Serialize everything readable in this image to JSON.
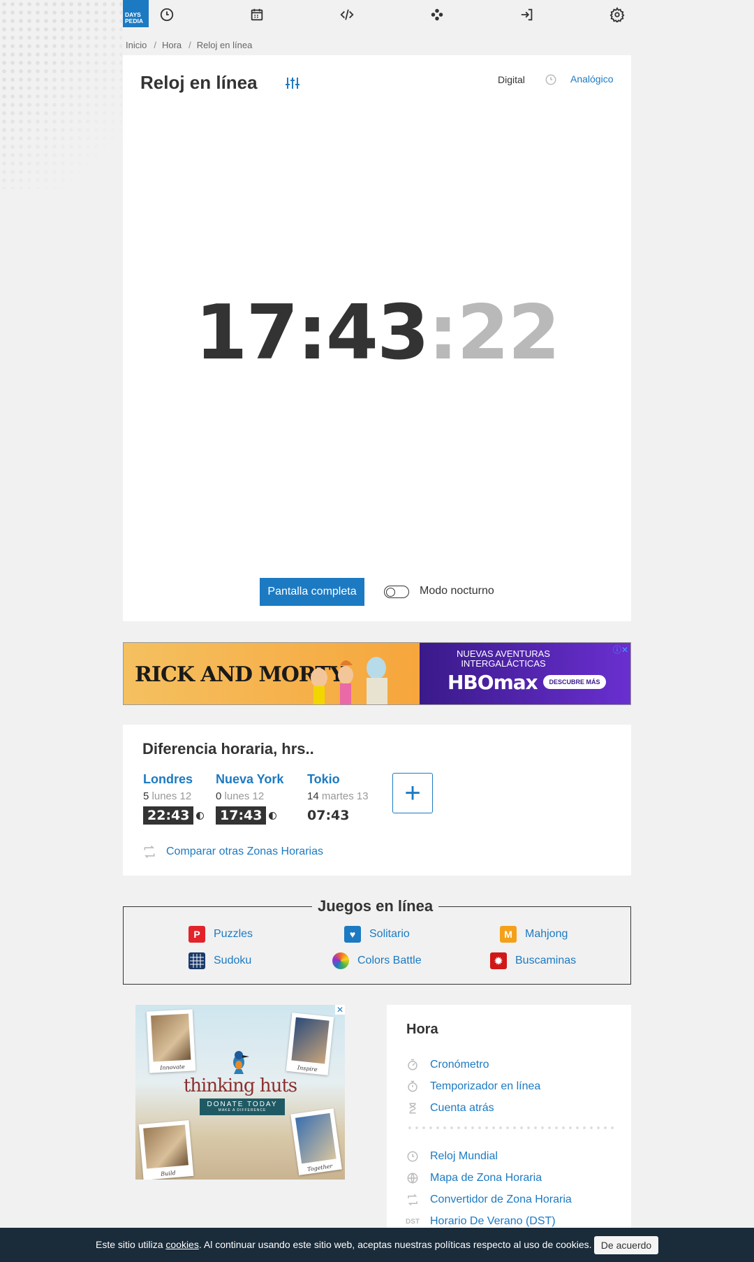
{
  "logo": {
    "line1": "DAYS",
    "line2": "PEDIA"
  },
  "breadcrumb": {
    "items": [
      "Inicio",
      "Hora",
      "Reloj en línea"
    ],
    "sep": "/"
  },
  "clock": {
    "title": "Reloj en línea",
    "mode_digital": "Digital",
    "mode_analog": "Analógico",
    "time_hm": "17:43",
    "time_sec": ":22",
    "fullscreen_label": "Pantalla completa",
    "night_mode_label": "Modo nocturno",
    "night_mode_on": false
  },
  "ad_banner": {
    "brand_left": "RICK AND MORTY",
    "headline": "NUEVAS AVENTURAS INTERGALÁCTICAS",
    "brand_right": "HBOmax",
    "cta": "DESCUBRE MÁS",
    "info": "ⓘ✕"
  },
  "time_diff": {
    "title": "Diferencia horaria, hrs..",
    "cities": [
      {
        "name": "Londres",
        "offset": "5",
        "day": "lunes 12",
        "time": "22:43",
        "night": true
      },
      {
        "name": "Nueva York",
        "offset": "0",
        "day": "lunes 12",
        "time": "17:43",
        "night": true
      },
      {
        "name": "Tokio",
        "offset": "14",
        "day": "martes 13",
        "time": "07:43",
        "night": false
      }
    ],
    "add_label": "+",
    "compare_label": "Comparar otras Zonas Horarias"
  },
  "games": {
    "title": "Juegos en línea",
    "items": [
      {
        "label": "Puzzles",
        "icon": "puzzle-icon",
        "color": "#e2232a"
      },
      {
        "label": "Solitario",
        "icon": "heart-card-icon",
        "color": "#1c7ac2"
      },
      {
        "label": "Mahjong",
        "icon": "mahjong-icon",
        "color": "#f3a11b"
      },
      {
        "label": "Sudoku",
        "icon": "sudoku-grid-icon",
        "color": "#1a3a6a"
      },
      {
        "label": "Colors Battle",
        "icon": "colors-icon",
        "color": "#f26a22"
      },
      {
        "label": "Buscaminas",
        "icon": "mine-icon",
        "color": "#d01818"
      }
    ]
  },
  "ad_square": {
    "title": "thinking huts",
    "donate": "DONATE TODAY",
    "donate_sub": "MAKE A DIFFERENCE",
    "captions": [
      "Innovate",
      "Inspire",
      "Build",
      "Together"
    ],
    "close": "✕"
  },
  "hora": {
    "title": "Hora",
    "group1": [
      {
        "label": "Cronómetro",
        "icon": "stopwatch-icon"
      },
      {
        "label": "Temporizador en línea",
        "icon": "timer-icon"
      },
      {
        "label": "Cuenta atrás",
        "icon": "countdown-icon"
      }
    ],
    "group2": [
      {
        "label": "Reloj Mundial",
        "icon": "clock-icon"
      },
      {
        "label": "Mapa de Zona Horaria",
        "icon": "globe-icon"
      },
      {
        "label": "Convertidor de Zona Horaria",
        "icon": "convert-icon"
      },
      {
        "label": "Horario De Verano (DST)",
        "icon": "dst-icon",
        "badge": "DST"
      }
    ]
  },
  "cookie": {
    "before": "Este sitio utiliza ",
    "link": "cookies",
    "after": ". Al continuar usando este sitio web, aceptas nuestras políticas respecto al uso de cookies.",
    "button": "De acuerdo"
  },
  "colors": {
    "accent": "#1c7ac2",
    "text": "#333333",
    "cookie_bg": "#1a2b3a"
  }
}
